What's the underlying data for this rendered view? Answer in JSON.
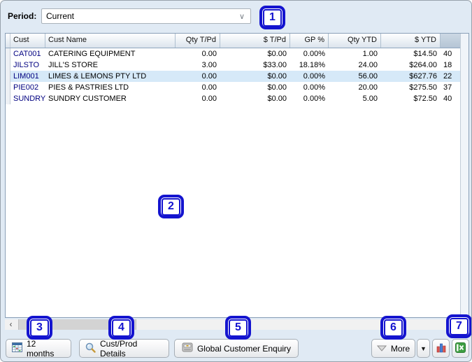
{
  "period": {
    "label": "Period:",
    "value": "Current",
    "chevron_icon": "chevron-down"
  },
  "grid": {
    "headers": {
      "cust": "Cust",
      "cust_name": "Cust Name",
      "qty_tpd": "Qty T/Pd",
      "amt_tpd": "$ T/Pd",
      "gp_pct": "GP %",
      "qty_ytd": "Qty YTD",
      "amt_ytd": "$ YTD"
    },
    "rows": [
      {
        "code": "CAT001",
        "name": "CATERING EQUIPMENT",
        "qty_tpd": "0.00",
        "amt_tpd": "$0.00",
        "gp_pct": "0.00%",
        "qty_ytd": "1.00",
        "amt_ytd": "$14.50",
        "clipped": "40"
      },
      {
        "code": "JILSTO",
        "name": "JILL'S STORE",
        "qty_tpd": "3.00",
        "amt_tpd": "$33.00",
        "gp_pct": "18.18%",
        "qty_ytd": "24.00",
        "amt_ytd": "$264.00",
        "clipped": "18"
      },
      {
        "code": "LIM001",
        "name": "LIMES & LEMONS PTY LTD",
        "qty_tpd": "0.00",
        "amt_tpd": "$0.00",
        "gp_pct": "0.00%",
        "qty_ytd": "56.00",
        "amt_ytd": "$627.76",
        "clipped": "22"
      },
      {
        "code": "PIE002",
        "name": "PIES & PASTRIES LTD",
        "qty_tpd": "0.00",
        "amt_tpd": "$0.00",
        "gp_pct": "0.00%",
        "qty_ytd": "20.00",
        "amt_ytd": "$275.50",
        "clipped": "37"
      },
      {
        "code": "SUNDRY",
        "name": "SUNDRY CUSTOMER",
        "qty_tpd": "0.00",
        "amt_tpd": "$0.00",
        "gp_pct": "0.00%",
        "qty_ytd": "5.00",
        "amt_ytd": "$72.50",
        "clipped": "40"
      }
    ],
    "selected_row_code": "LIM001"
  },
  "hscrollbar": {
    "left_arrow": "‹"
  },
  "toolbar": {
    "months_button": {
      "label": "12 months",
      "icon": "calendar-table-icon"
    },
    "custprod_button": {
      "label": "Cust/Prod Details",
      "icon": "magnifier-icon"
    },
    "global_button": {
      "label": "Global Customer Enquiry",
      "icon": "drawer-icon"
    },
    "more_button": {
      "label": "More",
      "icon": "triangle-down-icon"
    },
    "more_split_caret": "▼",
    "chart_button": {
      "icon": "bar-chart-icon"
    },
    "excel_button": {
      "icon": "excel-export-icon"
    }
  },
  "annotations": {
    "badges": [
      "1",
      "2",
      "3",
      "4",
      "5",
      "6",
      "7"
    ]
  },
  "colors": {
    "annotation_blue": "#1414cf",
    "row_highlight": "#d6e9f8",
    "customer_code_navy": "#000080",
    "window_background": "#e0eaf4",
    "excel_green": "#3d9e41",
    "chart_bar_red": "#d9534f",
    "chart_bar_blue": "#4a7fd4"
  }
}
